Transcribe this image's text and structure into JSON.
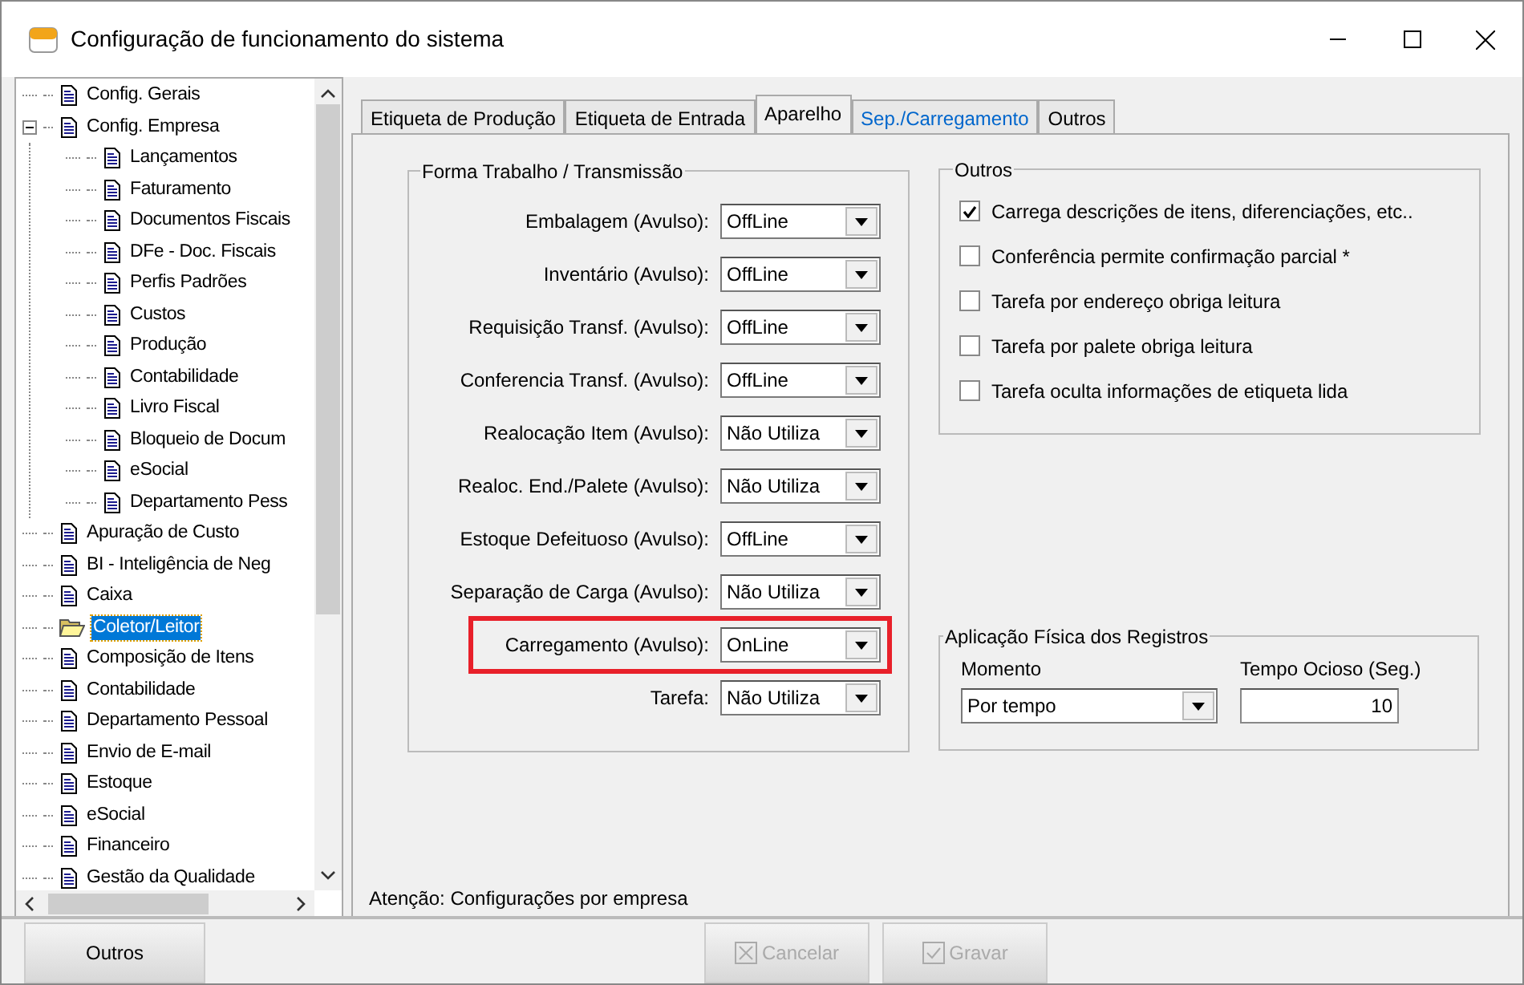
{
  "window": {
    "title": "Configuração de funcionamento do sistema"
  },
  "tree": [
    {
      "label": "Config. Gerais",
      "selected": false
    },
    {
      "label": "Config. Empresa",
      "selected": false,
      "expanded": true,
      "children": [
        {
          "label": "Lançamentos",
          "selected": false
        },
        {
          "label": "Faturamento",
          "selected": false
        },
        {
          "label": "Documentos Fiscais",
          "selected": false
        },
        {
          "label": "DFe - Doc. Fiscais",
          "selected": false
        },
        {
          "label": "Perfis Padrões",
          "selected": false
        },
        {
          "label": "Custos",
          "selected": false
        },
        {
          "label": "Produção",
          "selected": false
        },
        {
          "label": "Contabilidade",
          "selected": false
        },
        {
          "label": "Livro Fiscal",
          "selected": false
        },
        {
          "label": "Bloqueio de Docum",
          "selected": false
        },
        {
          "label": "eSocial",
          "selected": false
        },
        {
          "label": "Departamento Pess",
          "selected": false
        }
      ]
    },
    {
      "label": "Apuração de Custo",
      "selected": false
    },
    {
      "label": "BI - Inteligência de Neg",
      "selected": false
    },
    {
      "label": "Caixa",
      "selected": false
    },
    {
      "label": "Coletor/Leitor",
      "selected": true
    },
    {
      "label": "Composição de Itens",
      "selected": false
    },
    {
      "label": "Contabilidade",
      "selected": false
    },
    {
      "label": "Departamento Pessoal",
      "selected": false
    },
    {
      "label": "Envio de E-mail",
      "selected": false
    },
    {
      "label": "Estoque",
      "selected": false
    },
    {
      "label": "eSocial",
      "selected": false
    },
    {
      "label": "Financeiro",
      "selected": false
    },
    {
      "label": "Gestão da Qualidade",
      "selected": false
    }
  ],
  "tabs": [
    {
      "label": "Etiqueta de Produção",
      "selected": false,
      "kind": "plain"
    },
    {
      "label": "Etiqueta de Entrada",
      "selected": false,
      "kind": "plain"
    },
    {
      "label": "Aparelho",
      "selected": true,
      "kind": "plain"
    },
    {
      "label": "Sep./Carregamento",
      "selected": false,
      "kind": "link"
    },
    {
      "label": "Outros",
      "selected": false,
      "kind": "plain"
    }
  ],
  "forma": {
    "title": "Forma Trabalho / Transmissão",
    "rows": [
      {
        "label": "Embalagem (Avulso):",
        "value": "OffLine",
        "highlighted": false
      },
      {
        "label": "Inventário (Avulso):",
        "value": "OffLine",
        "highlighted": false
      },
      {
        "label": "Requisição Transf. (Avulso):",
        "value": "OffLine",
        "highlighted": false
      },
      {
        "label": "Conferencia Transf. (Avulso):",
        "value": "OffLine",
        "highlighted": false
      },
      {
        "label": "Realocação Item (Avulso):",
        "value": "Não Utiliza",
        "highlighted": false
      },
      {
        "label": "Realoc. End./Palete (Avulso):",
        "value": "Não Utiliza",
        "highlighted": false
      },
      {
        "label": "Estoque Defeituoso (Avulso):",
        "value": "OffLine",
        "highlighted": false
      },
      {
        "label": "Separação de Carga (Avulso):",
        "value": "Não Utiliza",
        "highlighted": false
      },
      {
        "label": "Carregamento (Avulso):",
        "value": "OnLine",
        "highlighted": true
      },
      {
        "label": "Tarefa:",
        "value": "Não Utiliza",
        "highlighted": false
      }
    ]
  },
  "outros": {
    "title": "Outros",
    "options": [
      {
        "label": "Carrega descrições de itens, diferenciações, etc..",
        "checked": true
      },
      {
        "label": "Conferência permite confirmação parcial *",
        "checked": false
      },
      {
        "label": "Tarefa por endereço obriga leitura",
        "checked": false
      },
      {
        "label": "Tarefa por palete obriga leitura",
        "checked": false
      },
      {
        "label": "Tarefa oculta informações de etiqueta lida",
        "checked": false
      }
    ]
  },
  "aplicacao": {
    "title": "Aplicação Física dos Registros",
    "momento_label": "Momento",
    "momento_value": "Por tempo",
    "tempo_label": "Tempo Ocioso (Seg.)",
    "tempo_value": "10"
  },
  "note": "Atenção: Configurações por empresa",
  "buttons": [
    {
      "label": "Outros",
      "disabled": false,
      "kind": "plain"
    },
    {
      "label": "Cancelar",
      "disabled": true,
      "kind": "cancel"
    },
    {
      "label": "Gravar",
      "disabled": true,
      "kind": "save"
    }
  ]
}
